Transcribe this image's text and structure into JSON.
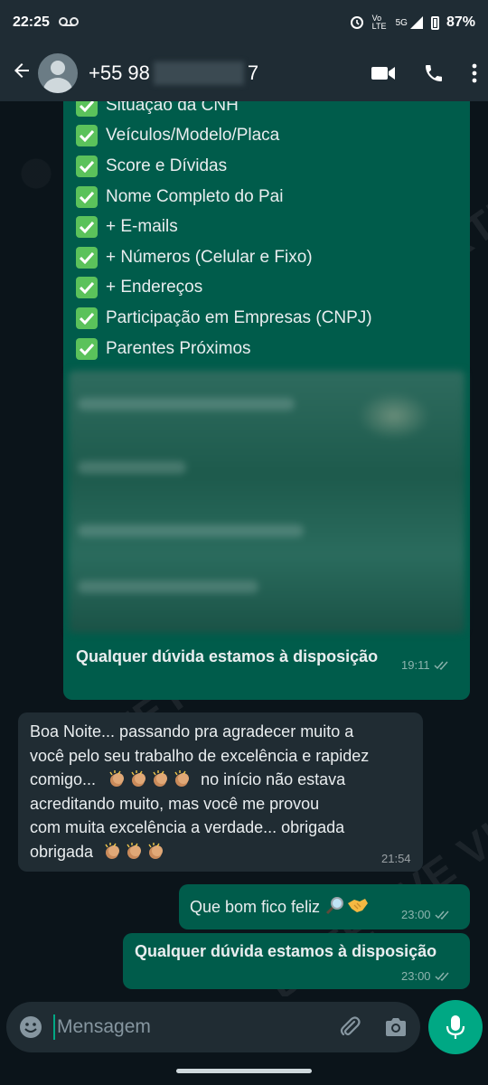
{
  "status": {
    "time": "22:25",
    "network_label": "Vo LTE",
    "signal_label": "5G",
    "battery": "87%"
  },
  "header": {
    "contact_prefix": "+55 98",
    "contact_suffix": "7"
  },
  "checklist": [
    "Situação da CNH",
    "Veículos/Modelo/Placa",
    "Score e Dívidas",
    "Nome Completo do Pai",
    "+ E-mails",
    "+ Números (Celular e Fixo)",
    "+ Endereços",
    "Participação em Empresas (CNPJ)",
    "Parentes Próximos"
  ],
  "messages": {
    "caption": "Qualquer dúvida estamos à disposição",
    "caption_time": "19:11",
    "incoming_line1": "Boa Noite... passando pra agradecer muito a",
    "incoming_line2": "você pelo seu trabalho de excelência e rapidez",
    "incoming_line3_pre": "comigo...",
    "incoming_line3_post": "no início não estava",
    "incoming_line4": "acreditando muito,  mas você me provou",
    "incoming_line5": "com muita excelência a verdade... obrigada",
    "incoming_line6": "obrigada",
    "incoming_time": "21:54",
    "reply1": "Que bom fico feliz",
    "reply1_time": "23:00",
    "reply2": "Qualquer dúvida estamos à disposição",
    "reply2_time": "23:00"
  },
  "composer": {
    "placeholder": "Mensagem"
  },
  "watermark_text": "DETETIVE VIRTUAL",
  "colors": {
    "outgoing_bubble": "#005c4b",
    "incoming_bubble": "#202c33",
    "accent": "#00a884",
    "check": "#5bc25b"
  }
}
